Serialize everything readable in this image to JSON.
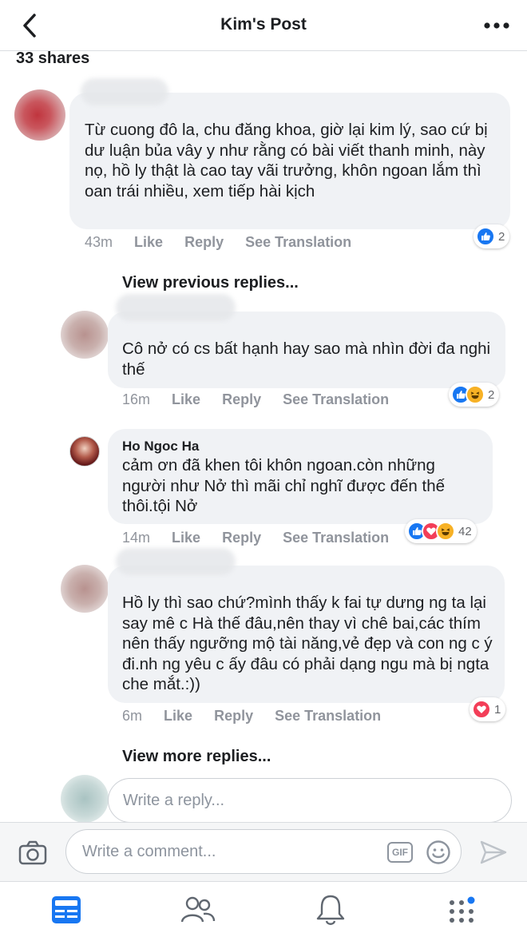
{
  "header": {
    "title": "Kim's Post"
  },
  "post": {
    "shares": "33 shares"
  },
  "comments": [
    {
      "author": "",
      "text": "Từ cuong đô la, chu đăng khoa, giờ lại kim lý, sao cứ bị dư luận bủa vây y như rằng có bài viết thanh minh, này nọ, hồ ly thật là cao tay vãi trưởng, khôn ngoan lắm thì oan trái nhiều, xem tiếp hài kịch",
      "time": "43m",
      "like": "Like",
      "reply": "Reply",
      "translate": "See Translation",
      "reactions": {
        "icons": [
          "like"
        ],
        "count": "2"
      }
    }
  ],
  "view_previous": "View previous replies...",
  "replies": [
    {
      "author": "",
      "text": "Cô nở có cs bất hạnh hay sao mà nhìn đời đa nghi thế",
      "time": "16m",
      "like": "Like",
      "reply": "Reply",
      "translate": "See Translation",
      "reactions": {
        "icons": [
          "like",
          "haha"
        ],
        "count": "2"
      }
    },
    {
      "author": "Ho Ngoc Ha",
      "text": "cảm ơn đã khen tôi khôn ngoan.còn những người như Nở thì mãi chỉ nghĩ được đến thế thôi.tội Nở",
      "time": "14m",
      "like": "Like",
      "reply": "Reply",
      "translate": "See Translation",
      "reactions": {
        "icons": [
          "like",
          "love",
          "haha"
        ],
        "count": "42"
      }
    },
    {
      "author": "",
      "text": "Hồ ly thì sao chứ?mình thấy k fai tự dưng ng ta lại say mê c Hà thế đâu,nên thay vì chê bai,các thím nên thấy ngưỡng mộ tài năng,vẻ đẹp và con ng c ý đi.nh ng yêu c ấy đâu có phải dạng ngu mà bị ngta che mắt.:))",
      "time": "6m",
      "like": "Like",
      "reply": "Reply",
      "translate": "See Translation",
      "reactions": {
        "icons": [
          "love"
        ],
        "count": "1"
      }
    }
  ],
  "view_more": "View more replies...",
  "reply_box": {
    "placeholder": "Write a reply..."
  },
  "composer": {
    "placeholder": "Write a comment...",
    "gif_label": "GIF"
  },
  "tabs": [
    "news-feed-icon",
    "friends-icon",
    "notifications-icon",
    "menu-icon"
  ],
  "colors": {
    "accent": "#1877f2",
    "like": "#1877f2",
    "love": "#f33e58",
    "haha": "#f7b125",
    "meta": "#90949c"
  }
}
